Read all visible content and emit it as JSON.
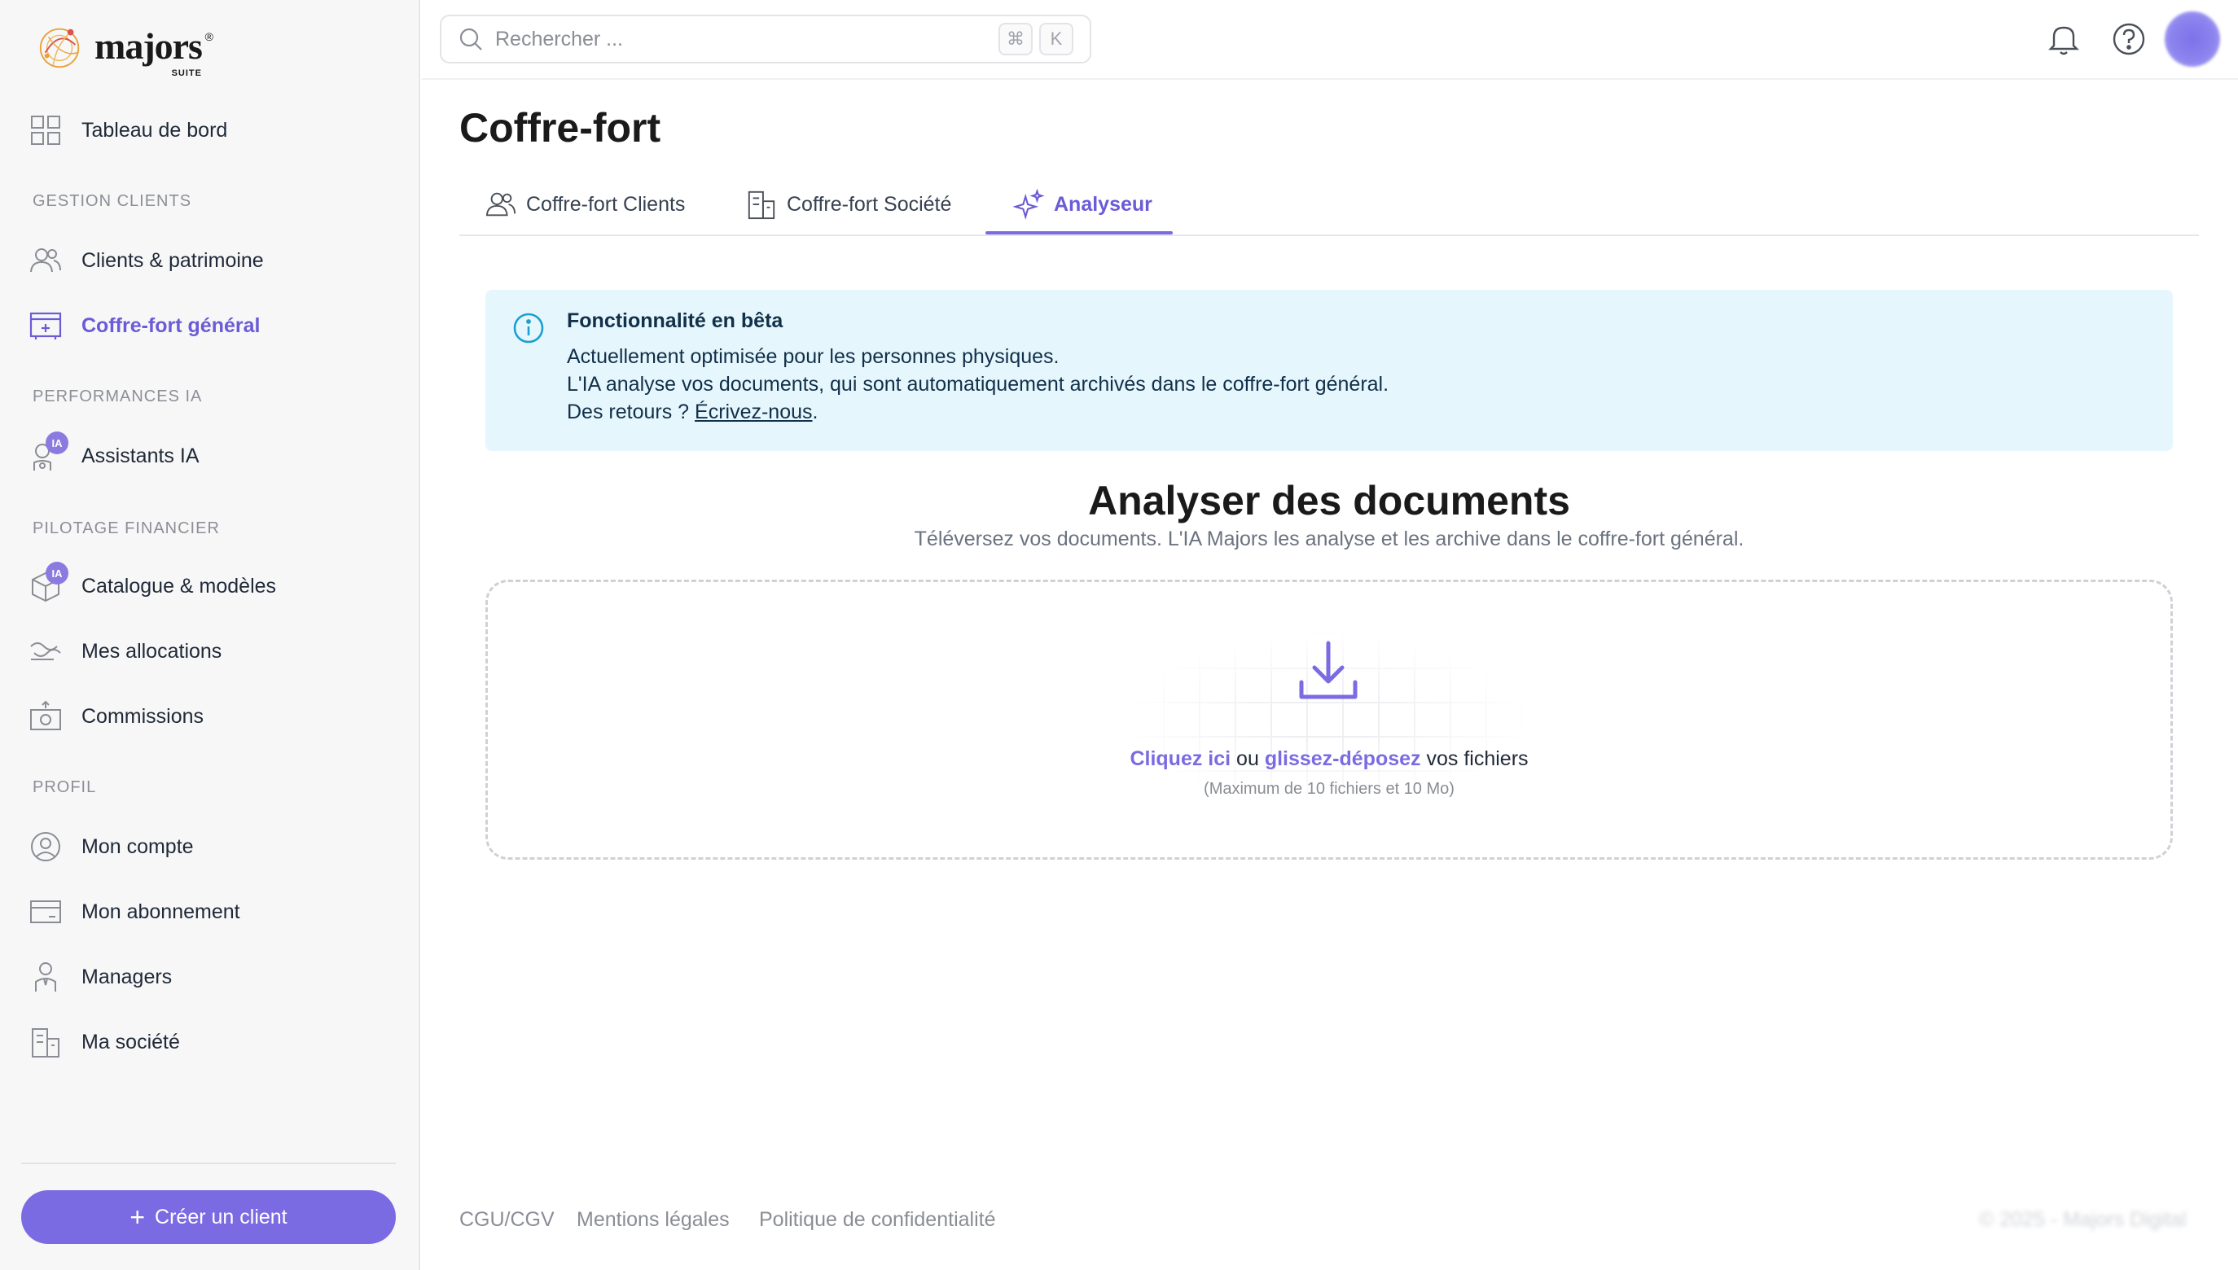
{
  "brand": {
    "name": "majors",
    "suffix": "SUITE",
    "registered": "®"
  },
  "sidebar": {
    "dashboard": "Tableau de bord",
    "sections": {
      "clients": "GESTION CLIENTS",
      "performances": "PERFORMANCES IA",
      "pilotage": "PILOTAGE FINANCIER",
      "profil": "PROFIL"
    },
    "items": {
      "clients": "Clients & patrimoine",
      "coffre": "Coffre-fort général",
      "assistants": "Assistants IA",
      "catalogue": "Catalogue & modèles",
      "allocations": "Mes allocations",
      "commissions": "Commissions",
      "compte": "Mon compte",
      "abonnement": "Mon abonnement",
      "managers": "Managers",
      "societe": "Ma société"
    },
    "ia_badge": "IA",
    "create_button": "Créer un client",
    "create_button_icon": "+"
  },
  "topbar": {
    "search_placeholder": "Rechercher ...",
    "shortcut_keys": [
      "⌘",
      "K"
    ]
  },
  "page": {
    "title": "Coffre-fort",
    "tabs": [
      "Coffre-fort Clients",
      "Coffre-fort Société",
      "Analyseur"
    ],
    "active_tab": "Analyseur"
  },
  "beta": {
    "title": "Fonctionnalité en bêta",
    "line1": "Actuellement optimisée pour les personnes physiques.",
    "line2": "L'IA analyse vos documents, qui sont automatiquement archivés dans le coffre-fort général.",
    "line3_prefix": "Des retours ? ",
    "link": "Écrivez-nous",
    "line3_suffix": "."
  },
  "analyse": {
    "title": "Analyser des documents",
    "subtitle": "Téléversez vos documents. L'IA Majors les analyse et les archive dans le coffre-fort général.",
    "click": "Cliquez ici",
    "or": " ou ",
    "drag": "glissez-déposez",
    "files": " vos fichiers",
    "hint": "(Maximum de 10 fichiers et 10 Mo)"
  },
  "footer": {
    "links": [
      "CGU/CGV",
      "Mentions légales",
      "Politique de confidentialité"
    ],
    "copyright": "© 2025 - Majors Digital"
  },
  "colors": {
    "accent": "#7b6be3",
    "info_bg": "#e6f6fd",
    "info_icon": "#1a9fd0",
    "sidebar_bg": "#f7f7f8"
  }
}
